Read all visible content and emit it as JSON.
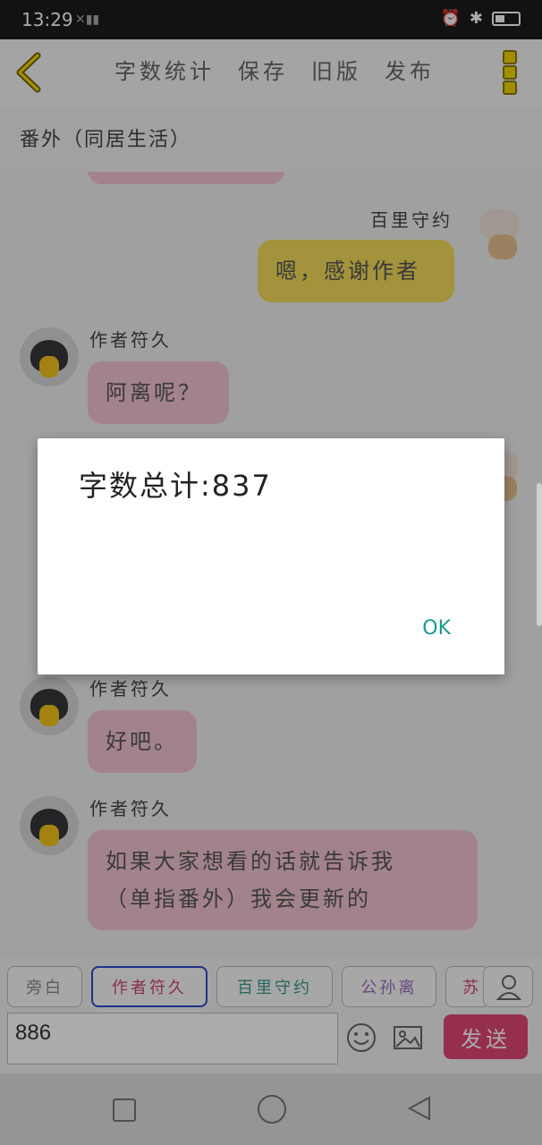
{
  "status": {
    "time": "13:29"
  },
  "toolbar": {
    "word_count": "字数统计",
    "save": "保存",
    "old_version": "旧版",
    "publish": "发布"
  },
  "chapter": {
    "title": "番外（同居生活）"
  },
  "messages": [
    {
      "sender": "百里守约",
      "text": "嗯，感谢作者"
    },
    {
      "sender": "作者符久",
      "text": "阿离呢？"
    },
    {
      "sender": "作者符久",
      "text": "好吧。"
    },
    {
      "sender": "作者符久",
      "text_line1": "如果大家想看的话就告诉我",
      "text_line2": "（单指番外）我会更新的"
    }
  ],
  "dialog": {
    "message": "字数总计:837",
    "ok": "OK"
  },
  "characters": [
    {
      "label": "旁白",
      "color": "#888888"
    },
    {
      "label": "作者符久",
      "color": "#d0446c"
    },
    {
      "label": "百里守约",
      "color": "#3a9a8a"
    },
    {
      "label": "公孙离",
      "color": "#9a6ac0"
    },
    {
      "label": "苏",
      "color": "#d0446c"
    }
  ],
  "input": {
    "value": "886"
  },
  "send": {
    "label": "发送"
  },
  "colors": {
    "accent": "#e04575",
    "bubble_author": "#f3c3cf",
    "bubble_user": "#f2dc5a"
  }
}
